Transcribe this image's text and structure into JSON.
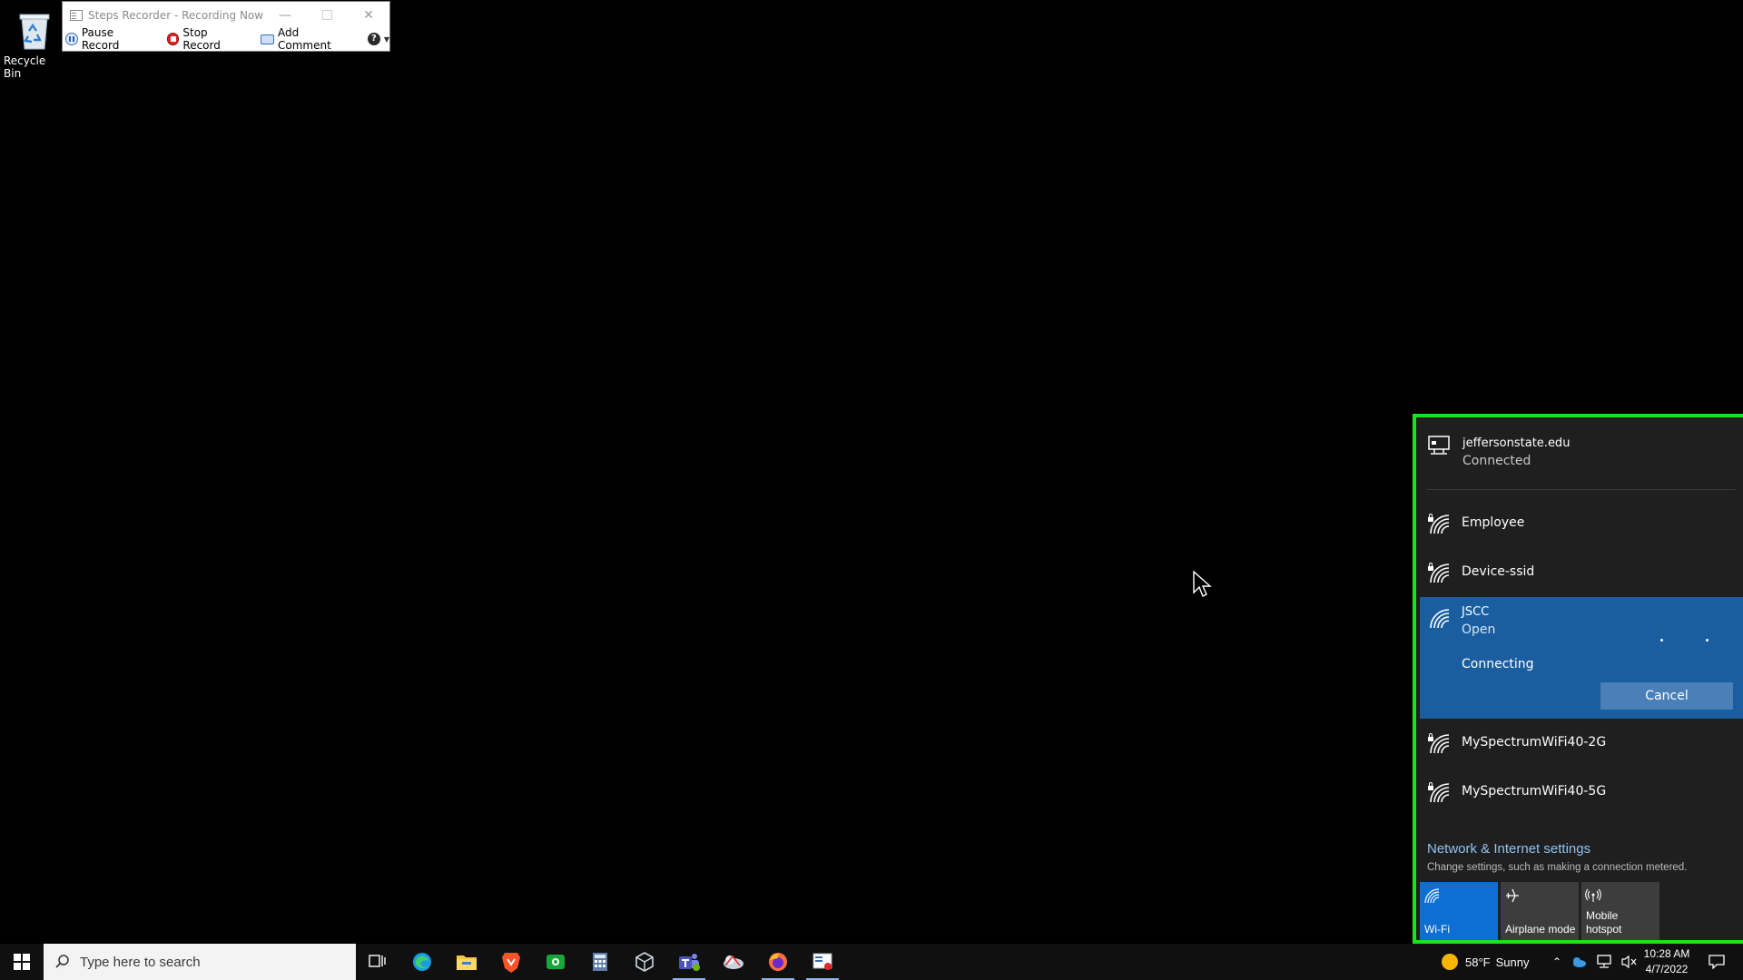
{
  "desktop": {
    "recycle_bin_label": "Recycle Bin"
  },
  "steps_recorder": {
    "title": "Steps Recorder - Recording Now",
    "pause_label": "Pause Record",
    "stop_label": "Stop Record",
    "comment_label": "Add Comment"
  },
  "network_flyout": {
    "connected": {
      "name": "jeffersonstate.edu",
      "status": "Connected"
    },
    "networks": [
      {
        "name": "Employee",
        "secured": true
      },
      {
        "name": "Device-ssid",
        "secured": true
      },
      {
        "name": "JSCC",
        "status": "Open",
        "state": "Connecting",
        "secured": false
      },
      {
        "name": "MySpectrumWiFi40-2G",
        "secured": true
      },
      {
        "name": "MySpectrumWiFi40-5G",
        "secured": true
      }
    ],
    "cancel_label": "Cancel",
    "settings_link": "Network & Internet settings",
    "settings_sub": "Change settings, such as making a connection metered.",
    "tiles": {
      "wifi": "Wi-Fi",
      "airplane": "Airplane mode",
      "hotspot_line1": "Mobile",
      "hotspot_line2": "hotspot"
    },
    "highlight_color": "#1fe01f",
    "accent_color": "#1a5ea0"
  },
  "taskbar": {
    "search_placeholder": "Type here to search",
    "weather_temp": "58°F",
    "weather_text": "Sunny",
    "time": "10:28 AM",
    "date": "4/7/2022",
    "apps": [
      "task-view-icon",
      "edge-icon",
      "file-explorer-icon",
      "brave-icon",
      "app-green-icon",
      "calculator-icon",
      "virtualbox-icon",
      "teams-icon",
      "cloud-app-icon",
      "firefox-icon",
      "steps-recorder-icon"
    ]
  }
}
